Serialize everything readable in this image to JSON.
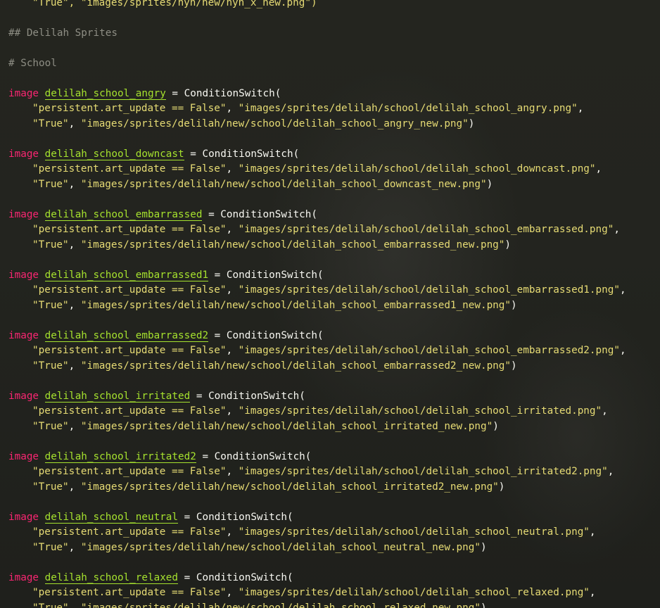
{
  "editor": {
    "top_line": "\"True\", \"images/sprites/nyn/new/nyn_x_new.png\")",
    "section_heading": "## Delilah Sprites",
    "subsection_heading": "# School",
    "image_keyword": "image",
    "assign_op": "=",
    "call_name": "ConditionSwitch",
    "open_paren": "(",
    "condition_1": "\"persistent.art_update == False\"",
    "condition_2": "\"True\"",
    "comma": ",",
    "close_paren": ")",
    "definitions": [
      {
        "name": "delilah_school_angry",
        "old_path": "\"images/sprites/delilah/school/delilah_school_angry.png\"",
        "new_path": "\"images/sprites/delilah/new/school/delilah_school_angry_new.png\""
      },
      {
        "name": "delilah_school_downcast",
        "old_path": "\"images/sprites/delilah/school/delilah_school_downcast.png\"",
        "new_path": "\"images/sprites/delilah/new/school/delilah_school_downcast_new.png\""
      },
      {
        "name": "delilah_school_embarrassed",
        "old_path": "\"images/sprites/delilah/school/delilah_school_embarrassed.png\"",
        "new_path": "\"images/sprites/delilah/new/school/delilah_school_embarrassed_new.png\""
      },
      {
        "name": "delilah_school_embarrassed1",
        "old_path": "\"images/sprites/delilah/school/delilah_school_embarrassed1.png\"",
        "new_path": "\"images/sprites/delilah/new/school/delilah_school_embarrassed1_new.png\""
      },
      {
        "name": "delilah_school_embarrassed2",
        "old_path": "\"images/sprites/delilah/school/delilah_school_embarrassed2.png\"",
        "new_path": "\"images/sprites/delilah/new/school/delilah_school_embarrassed2_new.png\""
      },
      {
        "name": "delilah_school_irritated",
        "old_path": "\"images/sprites/delilah/school/delilah_school_irritated.png\"",
        "new_path": "\"images/sprites/delilah/new/school/delilah_school_irritated_new.png\""
      },
      {
        "name": "delilah_school_irritated2",
        "old_path": "\"images/sprites/delilah/school/delilah_school_irritated2.png\"",
        "new_path": "\"images/sprites/delilah/new/school/delilah_school_irritated2_new.png\""
      },
      {
        "name": "delilah_school_neutral",
        "old_path": "\"images/sprites/delilah/school/delilah_school_neutral.png\"",
        "new_path": "\"images/sprites/delilah/new/school/delilah_school_neutral_new.png\""
      },
      {
        "name": "delilah_school_relaxed",
        "old_path": "\"images/sprites/delilah/school/delilah_school_relaxed.png\"",
        "new_path": "\"images/sprites/delilah/new/school/delilah_school_relaxed_new.png\""
      }
    ]
  },
  "theme": {
    "background": "#23241f",
    "keyword": "#f92672",
    "entity_name": "#a6e22e",
    "string": "#e6db74",
    "comment": "#8e8e84",
    "text": "#f8f8f2"
  }
}
